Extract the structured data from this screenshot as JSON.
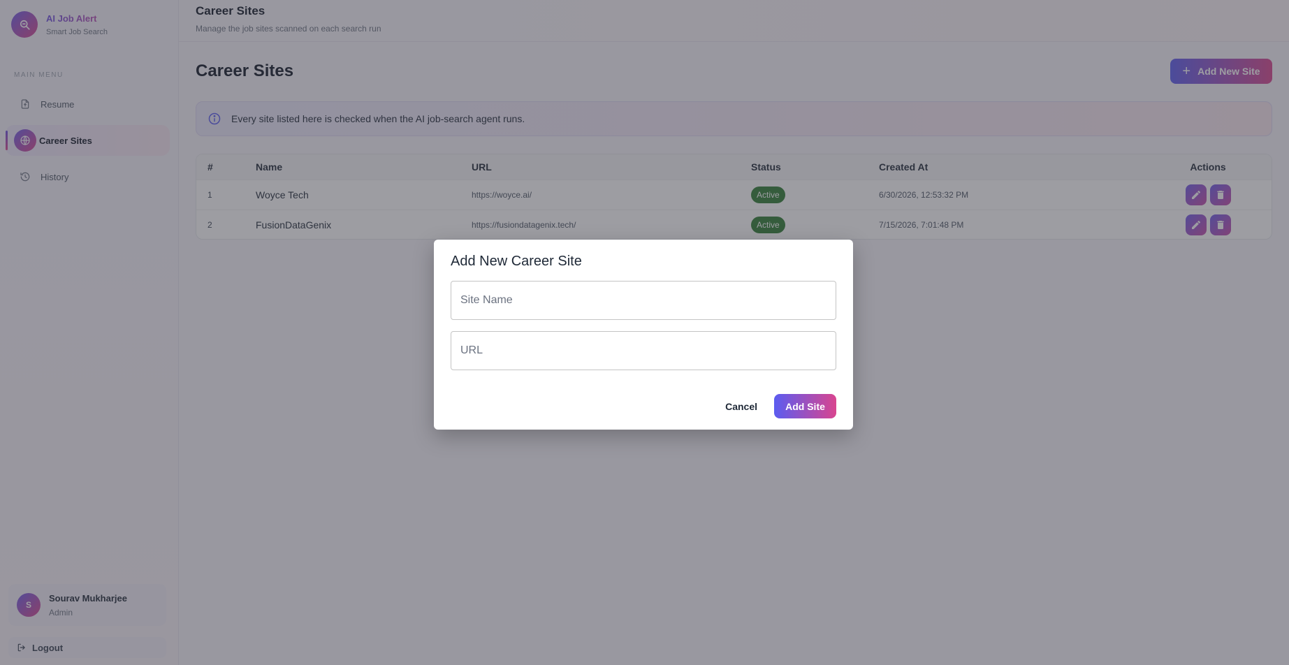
{
  "brand": {
    "title": "AI Job Alert",
    "subtitle": "Smart Job Search"
  },
  "sidebar": {
    "menu_heading": "MAIN MENU",
    "items": [
      {
        "label": "Resume",
        "icon": "file-upload-icon",
        "active": false
      },
      {
        "label": "Career Sites",
        "icon": "globe-icon",
        "active": true
      },
      {
        "label": "History",
        "icon": "history-icon",
        "active": false
      }
    ]
  },
  "user": {
    "initial": "S",
    "name": "Sourav Mukharjee",
    "role": "Admin"
  },
  "logout_label": "Logout",
  "topbar": {
    "title": "Career Sites",
    "subtitle": "Manage the job sites scanned on each search run"
  },
  "page": {
    "title": "Career Sites",
    "add_button_label": "Add New Site",
    "info_text": "Every site listed here is checked when the AI job-search agent runs."
  },
  "table": {
    "headers": [
      "#",
      "Name",
      "URL",
      "Status",
      "Created At",
      "Actions"
    ],
    "rows": [
      {
        "num": "1",
        "name": "Woyce Tech",
        "url": "https://woyce.ai/",
        "status": "Active",
        "created": "6/30/2026, 12:53:32 PM"
      },
      {
        "num": "2",
        "name": "FusionDataGenix",
        "url": "https://fusiondatagenix.tech/",
        "status": "Active",
        "created": "7/15/2026, 7:01:48 PM"
      }
    ]
  },
  "modal": {
    "title": "Add New Career Site",
    "site_name_placeholder": "Site Name",
    "url_placeholder": "URL",
    "cancel_label": "Cancel",
    "submit_label": "Add Site"
  },
  "colors": {
    "accent_start": "#5b5cf0",
    "accent_end": "#d9458f",
    "status_active": "#2e7d32"
  }
}
